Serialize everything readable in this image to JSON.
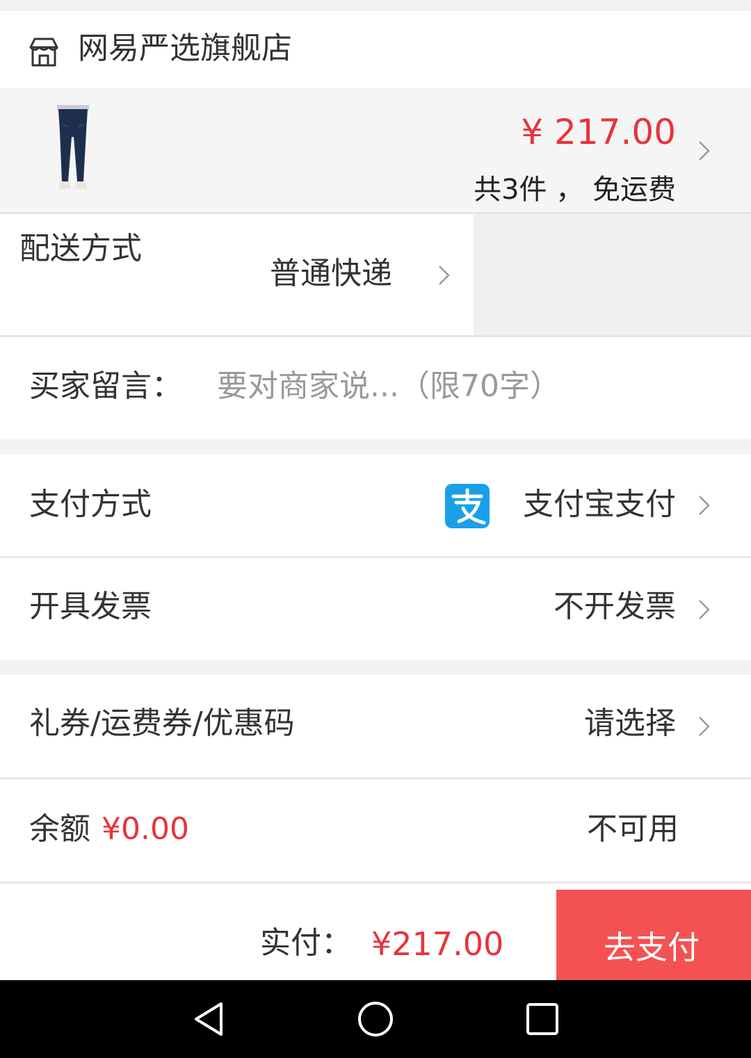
{
  "store": {
    "name": "网易严选旗舰店",
    "icon": "store-icon"
  },
  "product": {
    "image": "jeans-product-image",
    "price": "¥ 217.00",
    "summary": "共3件 ， 免运费",
    "price_color": "#e8333a"
  },
  "delivery": {
    "label": "配送方式",
    "value": "普通快递"
  },
  "message": {
    "label": "买家留言：",
    "placeholder": "要对商家说...（限70字）"
  },
  "payment": {
    "label": "支付方式",
    "value": "支付宝支付",
    "icon": "alipay-icon",
    "icon_color": "#1aa0e8"
  },
  "invoice": {
    "label": "开具发票",
    "value": "不开发票"
  },
  "coupon": {
    "label": "礼券/运费券/优惠码",
    "value": "请选择"
  },
  "balance": {
    "label": "余额",
    "amount": "¥0.00",
    "status": "不可用"
  },
  "footer": {
    "pay_label": "实付：",
    "pay_amount": "¥217.00",
    "pay_button": "去支付",
    "button_color": "#f45252"
  },
  "navbar": {
    "back": "back-icon",
    "home": "home-icon",
    "recents": "recents-icon"
  }
}
